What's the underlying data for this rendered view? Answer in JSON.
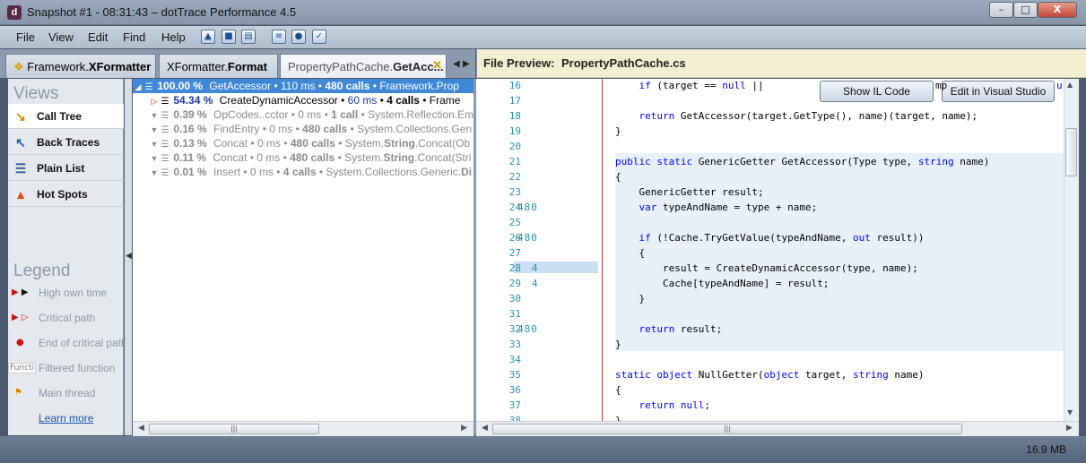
{
  "window": {
    "title": "Snapshot #1 - 08:31:43 – dotTrace Performance 4.5",
    "app_icon": "d"
  },
  "window_controls": {
    "minimize": "–",
    "maximize": "□",
    "close": "X"
  },
  "menu": [
    "File",
    "View",
    "Edit",
    "Find",
    "Help"
  ],
  "toolbar_icons": [
    "open-icon",
    "save-icon",
    "layout-icon",
    "compare-icon",
    "profile-icon",
    "export-icon"
  ],
  "tabs": [
    {
      "prefix": "Framework.",
      "bold": "XFormatter"
    },
    {
      "prefix": "XFormatter.",
      "bold": "Format"
    },
    {
      "prefix": "PropertyPathCache.",
      "bold": "GetAcc..."
    }
  ],
  "preview": {
    "label": "File Preview:",
    "file": "PropertyPathCache.cs"
  },
  "views": {
    "title": "Views",
    "items": [
      {
        "label": "Call Tree",
        "icon": "call-tree-icon"
      },
      {
        "label": "Back Traces",
        "icon": "back-traces-icon"
      },
      {
        "label": "Plain List",
        "icon": "plain-list-icon"
      },
      {
        "label": "Hot Spots",
        "icon": "hot-spots-icon"
      }
    ]
  },
  "legend": {
    "title": "Legend",
    "items": [
      {
        "label": "High own time",
        "icon": "high-own-time-icon"
      },
      {
        "label": "Critical path",
        "icon": "critical-path-icon"
      },
      {
        "label": "End of critical path",
        "icon": "end-critical-path-icon"
      },
      {
        "label": "Filtered function",
        "icon": "filtered-function-icon",
        "swatch": "Functi"
      },
      {
        "label": "Main thread",
        "icon": "main-thread-icon"
      }
    ],
    "learn_more": "Learn more"
  },
  "call_tree": [
    {
      "pct": "100.00 %",
      "name": "GetAccessor",
      "time": "110 ms",
      "calls": "480 calls",
      "ns": "Framework.Prop"
    },
    {
      "pct": "54.34 %",
      "name": "CreateDynamicAccessor",
      "time": "60 ms",
      "calls": "4 calls",
      "ns": "Frame"
    },
    {
      "pct": "0.39 %",
      "name": "OpCodes..cctor",
      "time": "0 ms",
      "calls": "1 call",
      "ns": "System.Reflection.Em"
    },
    {
      "pct": "0.16 %",
      "name": "FindEntry",
      "time": "0 ms",
      "calls": "480 calls",
      "ns": "System.Collections.Gen"
    },
    {
      "pct": "0.13 %",
      "name": "Concat",
      "time": "0 ms",
      "calls": "480 calls",
      "ns_pre": "System.",
      "ns_bold": "String",
      "ns_post": ".Concat(Ob"
    },
    {
      "pct": "0.11 %",
      "name": "Concat",
      "time": "0 ms",
      "calls": "480 calls",
      "ns_pre": "System.",
      "ns_bold": "String",
      "ns_post": ".Concat(Stri"
    },
    {
      "pct": "0.01 %",
      "name": "Insert",
      "time": "0 ms",
      "calls": "4 calls",
      "ns_pre": "System.Collections.Generic.",
      "ns_bold": "Di",
      "ns_post": ""
    }
  ],
  "code_buttons": {
    "show_il": "Show IL Code",
    "edit_vs": "Edit in Visual Studio"
  },
  "code": {
    "line_numbers": [
      "16",
      "17",
      "18",
      "19",
      "20",
      "21",
      "22",
      "23",
      "24",
      "25",
      "26",
      "27",
      "28",
      "29",
      "30",
      "31",
      "32",
      "33",
      "34",
      "35",
      "36",
      "37",
      "38"
    ],
    "hits": {
      "24": "480",
      "26": "480",
      "28": "4",
      "29": "4",
      "32": "480"
    },
    "lines": [
      "    if (target == null ||",
      "",
      "    return GetAccessor(target.GetType(), name)(target, name);",
      "}",
      "",
      "public static GenericGetter GetAccessor(Type type, string name)",
      "{",
      "    GenericGetter result;",
      "    var typeAndName = type + name;",
      "",
      "    if (!Cache.TryGetValue(typeAndName, out result))",
      "    {",
      "        result = CreateDynamicAccessor(type, name);",
      "        Cache[typeAndName] = result;",
      "    }",
      "",
      "    return result;",
      "}",
      "",
      "static object NullGetter(object target, string name)",
      "{",
      "    return null;",
      "}"
    ],
    "tail_17": "mp",
    "tail_18": "u"
  },
  "status": {
    "memory": "16.9 MB"
  },
  "colors": {
    "selection": "#3f88d8",
    "keyword": "#0000ff",
    "linenum": "#2b91af",
    "preview_bg": "#f2efd0"
  }
}
